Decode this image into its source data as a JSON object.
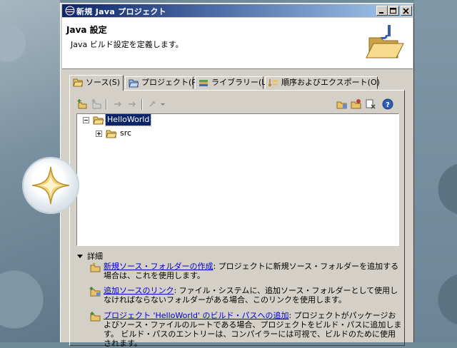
{
  "window": {
    "title": "新規 Java プロジェクト",
    "controls": {
      "minimize": "minimize",
      "maximize": "maximize",
      "close": "close"
    }
  },
  "banner": {
    "heading": "Java 設定",
    "description": "Java ビルド設定を定義します。"
  },
  "tabs": [
    {
      "label": "ソース(S)",
      "icon": "source-folder-icon",
      "active": true
    },
    {
      "label": "プロジェクト(P)",
      "icon": "project-icon",
      "active": false
    },
    {
      "label": "ライブラリー(L)",
      "icon": "library-icon",
      "active": false
    },
    {
      "label": "順序およびエクスポート(O)",
      "icon": "order-export-icon",
      "active": false
    }
  ],
  "tree": {
    "root": {
      "label": "HelloWorld",
      "expanded": true,
      "selected": true
    },
    "children": [
      {
        "label": "src",
        "expanded": false
      }
    ]
  },
  "details": {
    "header": "詳細",
    "items": [
      {
        "link": "新規ソース・フォルダーの作成",
        "text": ": プロジェクトに新規ソース・フォルダーを追加する場合は、これを使用します。"
      },
      {
        "link": "追加ソースのリンク",
        "text": ": ファイル・システムに、追加ソース・フォルダーとして使用しなければならないフォルダーがある場合、このリンクを使用します。"
      },
      {
        "link": "プロジェクト 'HelloWorld' のビルド・パスへの追加",
        "text": ": プロジェクトがパッケージおよびソース・ファイルのルートである場合、プロジェクトをビルド・パスに追加します。 ビルド・パスのエントリーは、コンパイラーには可視で、ビルドのために使用されます。"
      }
    ]
  },
  "colors": {
    "title_start": "#0a246a",
    "title_end": "#a6caf0",
    "link": "#0000cc",
    "dialog_bg": "#d4d0c8"
  }
}
